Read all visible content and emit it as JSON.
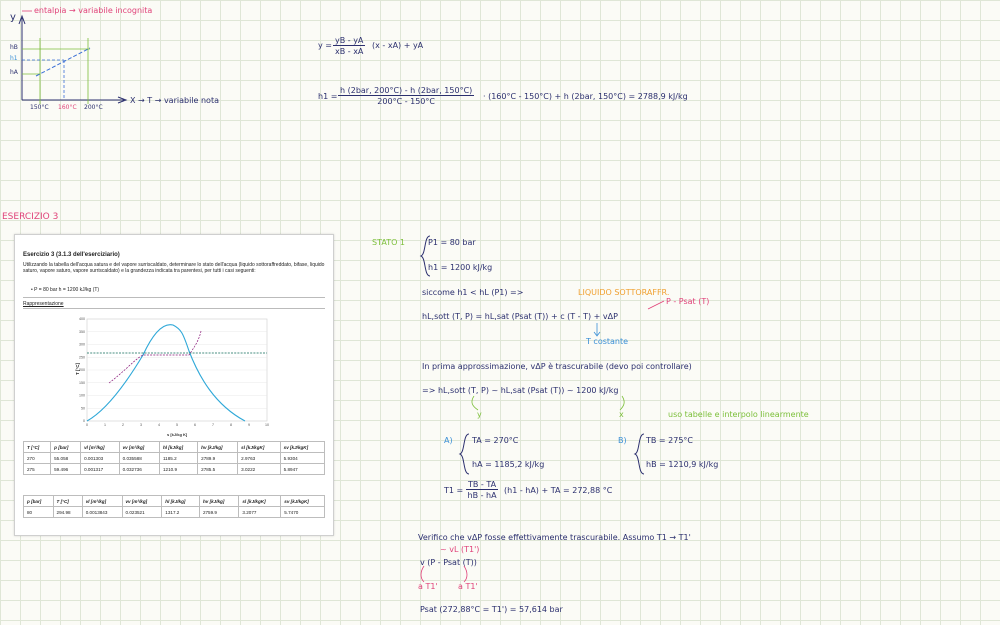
{
  "top_graph": {
    "y_label": "y",
    "y_note": "entalpia → variabile incognita",
    "y_ticks": [
      "hB",
      "h1",
      "hA"
    ],
    "x_label": "X → T → variabile nota",
    "x_ticks": [
      "150°C",
      "160°C",
      "200°C"
    ]
  },
  "formulas": {
    "interp_lhs": "y =",
    "interp_num": "yB - yA",
    "interp_den": "xB - xA",
    "interp_rhs": "(x - xA) + yA",
    "h1_lhs": "h1 =",
    "h1_num": "h (2bar, 200°C) - h (2bar, 150°C)",
    "h1_den": "200°C - 150°C",
    "h1_rhs": "· (160°C - 150°C) + h (2bar, 150°C) = 2788,9 kJ/kg"
  },
  "section_title": "ESERCIZIO 3",
  "panel": {
    "title": "Esercizio 3 (3.1.3 dell'eserciziario)",
    "body": "Utilizzando la tabella dell'acqua satura e del vapore surriscaldato, determinare lo stato dell'acqua (liquido sottoraffreddato, bifase, liquido saturo, vapore saturo, vapore surriscaldato) e la grandezza indicata tra parentesi, per tutti i casi seguenti:",
    "bullet": "•     P = 80 bar          h = 1200 kJ/kg     (T)",
    "rep": "Rappresentazione",
    "chart": {
      "y_label": "T [°C]",
      "x_label": "s [kJ/kg K]",
      "y_ticks": [
        "0",
        "50",
        "100",
        "150",
        "200",
        "250",
        "300",
        "350",
        "400"
      ],
      "x_ticks": [
        "0",
        "1",
        "2",
        "3",
        "4",
        "5",
        "6",
        "7",
        "8",
        "9",
        "10"
      ]
    },
    "table1": {
      "headers": [
        "T [°C]",
        "p [bar]",
        "vl [m³/kg]",
        "vv [m³/kg]",
        "hl [kJ/kg]",
        "hv [kJ/kg]",
        "sl [kJ/kgK]",
        "sv [kJ/kgK]"
      ],
      "rows": [
        [
          "270",
          "55.058",
          "0.001303",
          "0.035588",
          "1185.2",
          "2789.9",
          "2.9763",
          "5.9304"
        ],
        [
          "275",
          "59.496",
          "0.001317",
          "0.032736",
          "1210.9",
          "2785.5",
          "3.0222",
          "5.8947"
        ]
      ]
    },
    "table2": {
      "headers": [
        "p [bar]",
        "T [°C]",
        "vl [m³/kg]",
        "vv [m³/kg]",
        "hl [kJ/kg]",
        "hv [kJ/kg]",
        "sl [kJ/kgK]",
        "sv [kJ/kgK]"
      ],
      "rows": [
        [
          "80",
          "294.98",
          "0.0013843",
          "0.023521",
          "1317.2",
          "2759.9",
          "3.2077",
          "5.7470"
        ]
      ]
    }
  },
  "notes": {
    "stato": "STATO 1",
    "p1": "P1 = 80 bar",
    "h1": "h1 = 1200 kJ/kg",
    "siccome": "siccome   h1 < hL (P1)   =>",
    "liquido": "LIQUIDO SOTTORAFFR.",
    "p_psat": "P - Psat (T)",
    "eq_main": "hL,sott (T, P) = hL,sat (Psat (T)) + c (T - T) + vΔP",
    "t_costante": "T costante",
    "approx": "In prima approssimazione, vΔP è trascurabile   (devo poi controllare)",
    "approx_eq": "=>  hL,sott (T, P) ~  hL,sat (Psat (T)) ~ 1200 kJ/kg",
    "arrow_y": "y",
    "arrow_x": "x",
    "uso_tabelle": "uso tabelle  e interpolo linearmente",
    "a_label": "A)",
    "ta": "TA = 270°C",
    "ha": "hA = 1185,2 kJ/kg",
    "b_label": "B)",
    "tb": "TB = 275°C",
    "hb": "hB = 1210,9 kJ/kg",
    "t1_lhs": "T1 =",
    "t1_num": "TB - TA",
    "t1_den": "hB - hA",
    "t1_rhs": "(h1 - hA) + TA = 272,88 °C",
    "verifico": "Verifico che  vΔP fosse effettivamente trascurabile.  Assumo T1 → T1'",
    "vl_t": "~ vL (T1')",
    "v_expr": "v (P - Psat (T))",
    "a_t1": "a T1'",
    "a_t1b": "a T1'",
    "psat": "Psat (272,88°C = T1') = 57,614 bar"
  }
}
